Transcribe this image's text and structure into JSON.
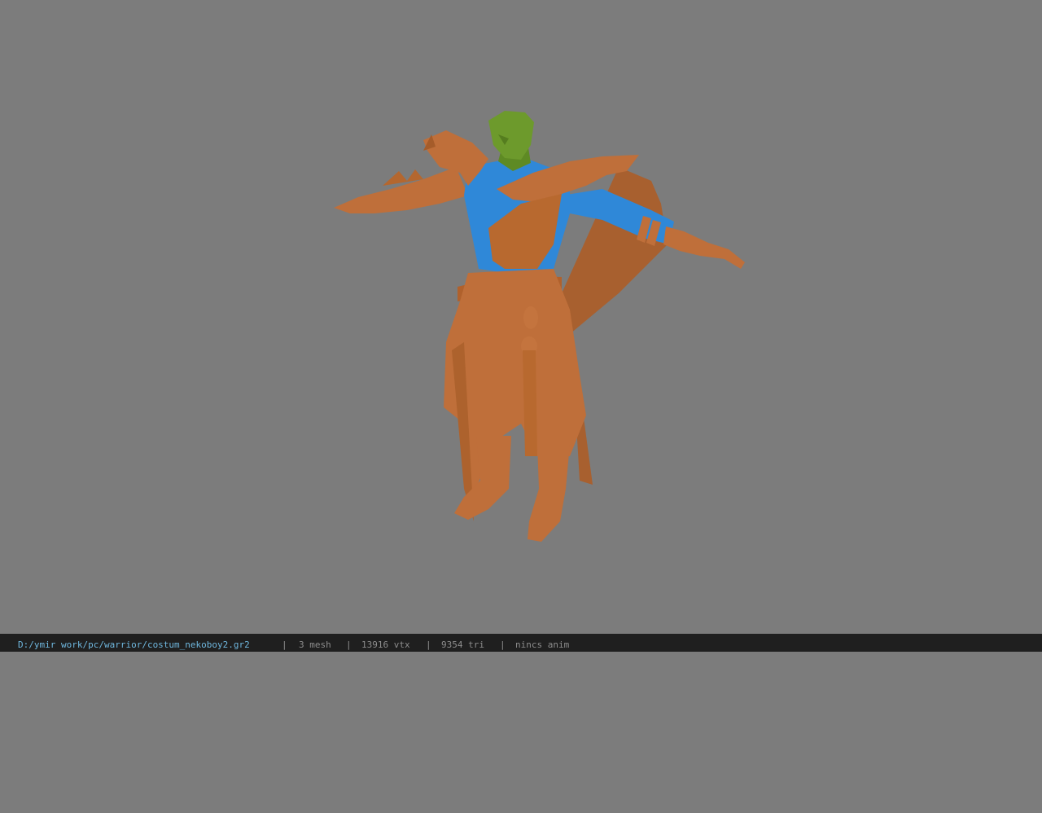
{
  "viewer": {
    "background": "#7c7c7c",
    "model_colors": {
      "cloth": "#bf6f3a",
      "shirt": "#2f88d8",
      "head": "#6d9a2c"
    }
  },
  "status": {
    "file": "D:/ymir work/pc/warrior/costum_nekoboy2.gr2",
    "separator": "|",
    "mesh": "3 mesh",
    "vtx": "13916 vtx",
    "tri": "9354 tri",
    "anim": "nincs anim"
  }
}
